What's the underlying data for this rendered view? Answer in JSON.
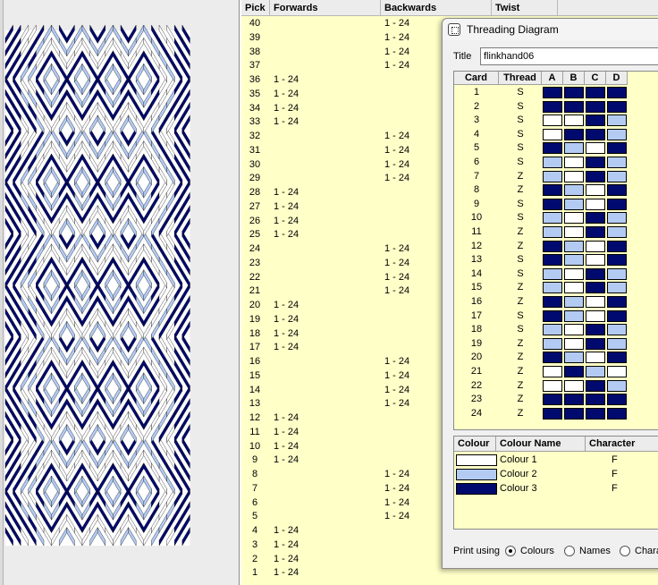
{
  "pick_table": {
    "headers": {
      "pick": "Pick",
      "forwards": "Forwards",
      "backwards": "Backwards",
      "twist": "Twist"
    },
    "rows": [
      {
        "pick": "40",
        "forwards": "",
        "backwards": "1 - 24"
      },
      {
        "pick": "39",
        "forwards": "",
        "backwards": "1 - 24"
      },
      {
        "pick": "38",
        "forwards": "",
        "backwards": "1 - 24"
      },
      {
        "pick": "37",
        "forwards": "",
        "backwards": "1 - 24"
      },
      {
        "pick": "36",
        "forwards": "1 - 24",
        "backwards": ""
      },
      {
        "pick": "35",
        "forwards": "1 - 24",
        "backwards": ""
      },
      {
        "pick": "34",
        "forwards": "1 - 24",
        "backwards": ""
      },
      {
        "pick": "33",
        "forwards": "1 - 24",
        "backwards": ""
      },
      {
        "pick": "32",
        "forwards": "",
        "backwards": "1 - 24"
      },
      {
        "pick": "31",
        "forwards": "",
        "backwards": "1 - 24"
      },
      {
        "pick": "30",
        "forwards": "",
        "backwards": "1 - 24"
      },
      {
        "pick": "29",
        "forwards": "",
        "backwards": "1 - 24"
      },
      {
        "pick": "28",
        "forwards": "1 - 24",
        "backwards": ""
      },
      {
        "pick": "27",
        "forwards": "1 - 24",
        "backwards": ""
      },
      {
        "pick": "26",
        "forwards": "1 - 24",
        "backwards": ""
      },
      {
        "pick": "25",
        "forwards": "1 - 24",
        "backwards": ""
      },
      {
        "pick": "24",
        "forwards": "",
        "backwards": "1 - 24"
      },
      {
        "pick": "23",
        "forwards": "",
        "backwards": "1 - 24"
      },
      {
        "pick": "22",
        "forwards": "",
        "backwards": "1 - 24"
      },
      {
        "pick": "21",
        "forwards": "",
        "backwards": "1 - 24"
      },
      {
        "pick": "20",
        "forwards": "1 - 24",
        "backwards": ""
      },
      {
        "pick": "19",
        "forwards": "1 - 24",
        "backwards": ""
      },
      {
        "pick": "18",
        "forwards": "1 - 24",
        "backwards": ""
      },
      {
        "pick": "17",
        "forwards": "1 - 24",
        "backwards": ""
      },
      {
        "pick": "16",
        "forwards": "",
        "backwards": "1 - 24"
      },
      {
        "pick": "15",
        "forwards": "",
        "backwards": "1 - 24"
      },
      {
        "pick": "14",
        "forwards": "",
        "backwards": "1 - 24"
      },
      {
        "pick": "13",
        "forwards": "",
        "backwards": "1 - 24"
      },
      {
        "pick": "12",
        "forwards": "1 - 24",
        "backwards": ""
      },
      {
        "pick": "11",
        "forwards": "1 - 24",
        "backwards": ""
      },
      {
        "pick": "10",
        "forwards": "1 - 24",
        "backwards": ""
      },
      {
        "pick": "9",
        "forwards": "1 - 24",
        "backwards": ""
      },
      {
        "pick": "8",
        "forwards": "",
        "backwards": "1 - 24"
      },
      {
        "pick": "7",
        "forwards": "",
        "backwards": "1 - 24"
      },
      {
        "pick": "6",
        "forwards": "",
        "backwards": "1 - 24"
      },
      {
        "pick": "5",
        "forwards": "",
        "backwards": "1 - 24"
      },
      {
        "pick": "4",
        "forwards": "1 - 24",
        "backwards": ""
      },
      {
        "pick": "3",
        "forwards": "1 - 24",
        "backwards": ""
      },
      {
        "pick": "2",
        "forwards": "1 - 24",
        "backwards": ""
      },
      {
        "pick": "1",
        "forwards": "1 - 24",
        "backwards": ""
      }
    ]
  },
  "dialog": {
    "title": "Threading Diagram",
    "title_label": "Title",
    "title_value": "flinkhand06",
    "card_headers": {
      "card": "Card",
      "thread": "Thread",
      "holes": [
        "A",
        "B",
        "C",
        "D"
      ]
    },
    "cards": [
      {
        "card": "1",
        "thread": "S",
        "holes": [
          3,
          3,
          3,
          3
        ]
      },
      {
        "card": "2",
        "thread": "S",
        "holes": [
          3,
          3,
          3,
          3
        ]
      },
      {
        "card": "3",
        "thread": "S",
        "holes": [
          1,
          1,
          3,
          2
        ]
      },
      {
        "card": "4",
        "thread": "S",
        "holes": [
          1,
          3,
          3,
          2
        ]
      },
      {
        "card": "5",
        "thread": "S",
        "holes": [
          3,
          2,
          1,
          3
        ]
      },
      {
        "card": "6",
        "thread": "S",
        "holes": [
          2,
          1,
          3,
          2
        ]
      },
      {
        "card": "7",
        "thread": "Z",
        "holes": [
          2,
          1,
          3,
          2
        ]
      },
      {
        "card": "8",
        "thread": "Z",
        "holes": [
          3,
          2,
          1,
          3
        ]
      },
      {
        "card": "9",
        "thread": "S",
        "holes": [
          3,
          2,
          1,
          3
        ]
      },
      {
        "card": "10",
        "thread": "S",
        "holes": [
          2,
          1,
          3,
          2
        ]
      },
      {
        "card": "11",
        "thread": "Z",
        "holes": [
          2,
          1,
          3,
          2
        ]
      },
      {
        "card": "12",
        "thread": "Z",
        "holes": [
          3,
          2,
          1,
          3
        ]
      },
      {
        "card": "13",
        "thread": "S",
        "holes": [
          3,
          2,
          1,
          3
        ]
      },
      {
        "card": "14",
        "thread": "S",
        "holes": [
          2,
          1,
          3,
          2
        ]
      },
      {
        "card": "15",
        "thread": "Z",
        "holes": [
          2,
          1,
          3,
          2
        ]
      },
      {
        "card": "16",
        "thread": "Z",
        "holes": [
          3,
          2,
          1,
          3
        ]
      },
      {
        "card": "17",
        "thread": "S",
        "holes": [
          3,
          2,
          1,
          3
        ]
      },
      {
        "card": "18",
        "thread": "S",
        "holes": [
          2,
          1,
          3,
          2
        ]
      },
      {
        "card": "19",
        "thread": "Z",
        "holes": [
          2,
          1,
          3,
          2
        ]
      },
      {
        "card": "20",
        "thread": "Z",
        "holes": [
          3,
          2,
          1,
          3
        ]
      },
      {
        "card": "21",
        "thread": "Z",
        "holes": [
          1,
          3,
          2,
          1
        ]
      },
      {
        "card": "22",
        "thread": "Z",
        "holes": [
          1,
          1,
          3,
          2
        ]
      },
      {
        "card": "23",
        "thread": "Z",
        "holes": [
          3,
          3,
          3,
          3
        ]
      },
      {
        "card": "24",
        "thread": "Z",
        "holes": [
          3,
          3,
          3,
          3
        ]
      }
    ],
    "colour_headers": {
      "colour": "Colour",
      "name": "Colour Name",
      "character": "Character"
    },
    "colours": [
      {
        "name": "Colour 1",
        "character": "F",
        "hex": "#ffffff"
      },
      {
        "name": "Colour 2",
        "character": "F",
        "hex": "#b3cbf3"
      },
      {
        "name": "Colour 3",
        "character": "F",
        "hex": "#000a6e"
      }
    ],
    "print_label": "Print using",
    "print_options": [
      {
        "label": "Colours",
        "selected": true
      },
      {
        "label": "Names",
        "selected": false
      },
      {
        "label": "Chara",
        "selected": false
      }
    ]
  },
  "colors": {
    "navy": "#000a6e",
    "light_blue": "#b3cbf3",
    "white": "#ffffff",
    "table_bg": "#ffffc8"
  }
}
